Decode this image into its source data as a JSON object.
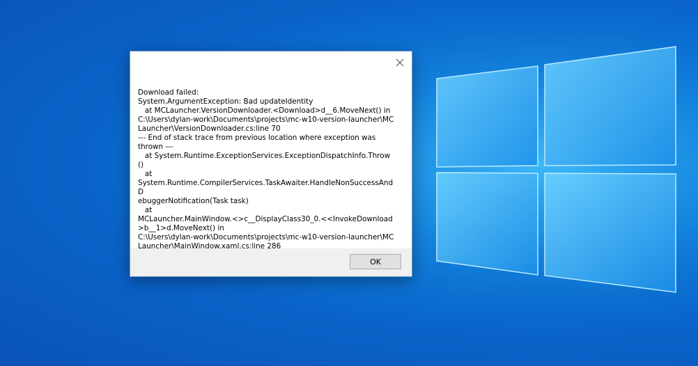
{
  "dialog": {
    "message_lines": [
      "Download failed:",
      "System.ArgumentException: Bad updateIdentity",
      "   at MCLauncher.VersionDownloader.<Download>d__6.MoveNext() in",
      "C:\\Users\\dylan-work\\Documents\\projects\\mc-w10-version-launcher\\MC",
      "Launcher\\VersionDownloader.cs:line 70",
      "--- End of stack trace from previous location where exception was",
      "thrown ---",
      "   at System.Runtime.ExceptionServices.ExceptionDispatchInfo.Throw()",
      "   at",
      "System.Runtime.CompilerServices.TaskAwaiter.HandleNonSuccessAndD",
      "ebuggerNotification(Task task)",
      "   at",
      "MCLauncher.MainWindow.<>c__DisplayClass30_0.<<InvokeDownload",
      ">b__1>d.MoveNext() in",
      "C:\\Users\\dylan-work\\Documents\\projects\\mc-w10-version-launcher\\MC",
      "Launcher\\MainWindow.xaml.cs:line 286"
    ],
    "ok_label": "OK",
    "close_icon": "close-icon"
  },
  "colors": {
    "desktop_background": "#0a63c8",
    "dialog_background": "#ffffff",
    "footer_background": "#f0f0f0",
    "button_background": "#e1e1e1"
  }
}
